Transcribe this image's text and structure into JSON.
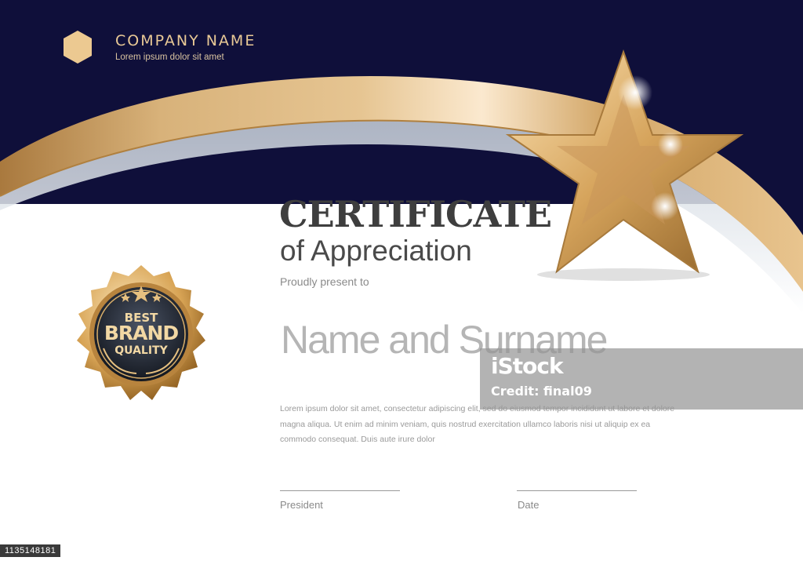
{
  "company": {
    "name": "COMPANY NAME",
    "tagline": "Lorem ipsum dolor sit amet",
    "logo_icon": "hexagon-icon"
  },
  "certificate": {
    "title": "CERTIFICATE",
    "subtitle": "of Appreciation",
    "present_text": "Proudly present to",
    "recipient_placeholder": "Name and Surname",
    "body": "Lorem ipsum dolor sit amet, consectetur adipiscing elit, sed do eiusmod tempor incididunt ut labore et dolore magna aliqua. Ut enim ad minim veniam, quis nostrud exercitation ullamco laboris nisi ut aliquip ex ea commodo consequat. Duis aute irure dolor"
  },
  "badge": {
    "line1": "BEST",
    "line2": "BRAND",
    "line3": "QUALITY",
    "icon": "laurel-seal-icon"
  },
  "signatures": {
    "left_label": "President",
    "right_label": "Date"
  },
  "watermark": {
    "logo": "iStock",
    "credit": "Credit: final09"
  },
  "stock_id": "1135148181",
  "colors": {
    "navy": "#0f0f3a",
    "gold": "#d9b37a",
    "title": "#3e3e3e"
  }
}
